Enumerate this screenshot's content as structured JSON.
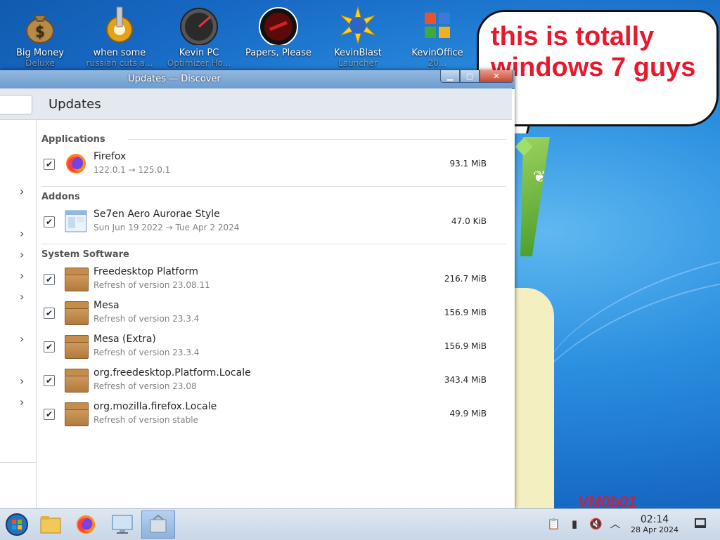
{
  "desktop": {
    "icons": [
      {
        "label": "Big Money",
        "sublabel": "Deluxe",
        "icon": "money-bag-icon"
      },
      {
        "label": "when some",
        "sublabel": "russian cuts a...",
        "icon": "gear-icon"
      },
      {
        "label": "Kevin PC",
        "sublabel": "Optimizer Ho...",
        "icon": "speedometer-icon"
      },
      {
        "label": "Papers, Please",
        "sublabel": "",
        "icon": "papers-please-icon"
      },
      {
        "label": "KevinBlast",
        "sublabel": "Launcher",
        "icon": "blast-launcher-icon"
      },
      {
        "label": "KevinOffice",
        "sublabel": "20...",
        "icon": "office-icon"
      }
    ],
    "bubble_text": "this is totally windows 7 guys",
    "watermark": "VM0b01"
  },
  "window": {
    "title": "Updates — Discover",
    "page_title": "Updates",
    "buttons": {
      "minimize": "▁",
      "maximize": "▢",
      "close": "✕"
    }
  },
  "sections": [
    {
      "name": "Applications",
      "items": [
        {
          "name": "Firefox",
          "version": "122.0.1 → 125.0.1",
          "size": "93.1 MiB",
          "checked": true,
          "icon": "firefox-icon"
        }
      ]
    },
    {
      "name": "Addons",
      "items": [
        {
          "name": "Se7en Aero Aurorae Style",
          "version": "Sun Jun 19 2022 → Tue Apr 2 2024",
          "size": "47.0 KiB",
          "checked": true,
          "icon": "aurorae-theme-icon"
        }
      ]
    },
    {
      "name": "System Software",
      "items": [
        {
          "name": "Freedesktop Platform",
          "version": "Refresh of version 23.08.11",
          "size": "216.7 MiB",
          "checked": true,
          "icon": "package-icon"
        },
        {
          "name": "Mesa",
          "version": "Refresh of version 23.3.4",
          "size": "156.9 MiB",
          "checked": true,
          "icon": "package-icon"
        },
        {
          "name": "Mesa (Extra)",
          "version": "Refresh of version 23.3.4",
          "size": "156.9 MiB",
          "checked": true,
          "icon": "package-icon"
        },
        {
          "name": "org.freedesktop.Platform.Locale",
          "version": "Refresh of version 23.08",
          "size": "343.4 MiB",
          "checked": true,
          "icon": "package-icon"
        },
        {
          "name": "org.mozilla.firefox.Locale",
          "version": "Refresh of version stable",
          "size": "49.9 MiB",
          "checked": true,
          "icon": "package-icon"
        }
      ]
    }
  ],
  "sidebar": {
    "chevron": "›"
  },
  "taskbar": {
    "apps": [
      "start-orb-icon",
      "file-manager-icon",
      "firefox-icon",
      "system-settings-icon",
      "discover-icon"
    ],
    "tray": [
      "clipboard-icon",
      "battery-icon",
      "volume-muted-icon",
      "chevron-up-icon"
    ],
    "time": "02:14",
    "date": "28 Apr 2024",
    "show_desktop": "show-desktop-icon"
  },
  "colors": {
    "accent": "#3daee9",
    "titlebar": "#7fa8d6",
    "bubble_text": "#e8192c"
  }
}
